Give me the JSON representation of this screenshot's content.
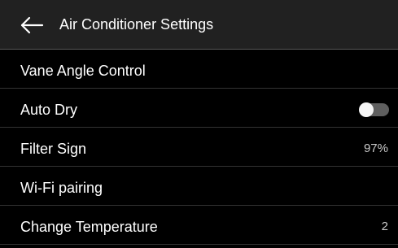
{
  "header": {
    "back_icon": "arrow-left-icon",
    "title": "Air Conditioner Settings"
  },
  "settings": {
    "vane_angle": {
      "label": "Vane Angle Control"
    },
    "auto_dry": {
      "label": "Auto Dry",
      "enabled": false
    },
    "filter_sign": {
      "label": "Filter Sign",
      "value": "97%"
    },
    "wifi_pairing": {
      "label": "Wi-Fi pairing"
    },
    "change_temperature": {
      "label": "Change Temperature",
      "value": "2"
    }
  },
  "colors": {
    "background": "#000000",
    "header_background": "#212121",
    "divider": "#333333",
    "toggle_track_off": "#5f5f5f",
    "toggle_knob": "#f5f5f5"
  }
}
